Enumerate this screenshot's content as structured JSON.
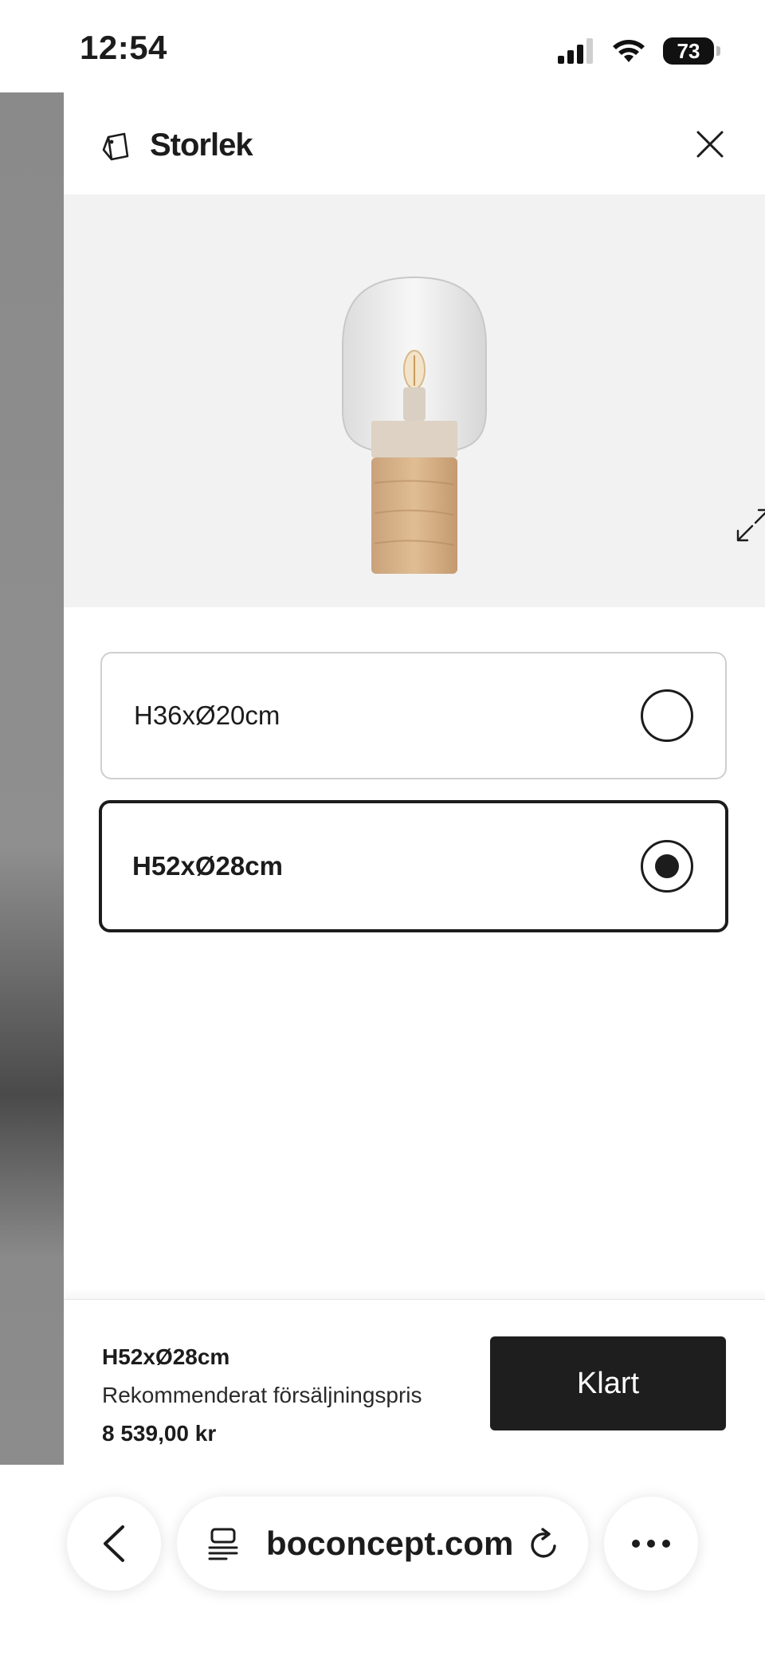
{
  "status_bar": {
    "time": "12:54",
    "battery": "73",
    "icons": [
      "cellular-signal-icon",
      "wifi-icon",
      "battery-icon"
    ]
  },
  "drawer": {
    "title": "Storlek",
    "title_icon": "tag-icon",
    "close_icon": "close-icon",
    "image": {
      "alt": "lamp",
      "expand_icon": "expand-icon"
    },
    "options": [
      {
        "label": "H36xØ20cm",
        "selected": false
      },
      {
        "label": "H52xØ28cm",
        "selected": true
      }
    ],
    "footer": {
      "selected_size": "H52xØ28cm",
      "price_label": "Rekommenderat försäljningspris",
      "price": "8 539,00 kr",
      "done_button": "Klart"
    }
  },
  "browser": {
    "url": "boconcept.com",
    "back_icon": "chevron-left-icon",
    "reader_icon": "reader-icon",
    "reload_icon": "reload-icon",
    "more_icon": "more-icon"
  },
  "colors": {
    "text": "#1c1c1c",
    "button_bg": "#1e1e1e",
    "image_bg": "#f2f2f2",
    "unselected_border": "#cfcfcf",
    "backdrop": "#8a8a8a"
  }
}
